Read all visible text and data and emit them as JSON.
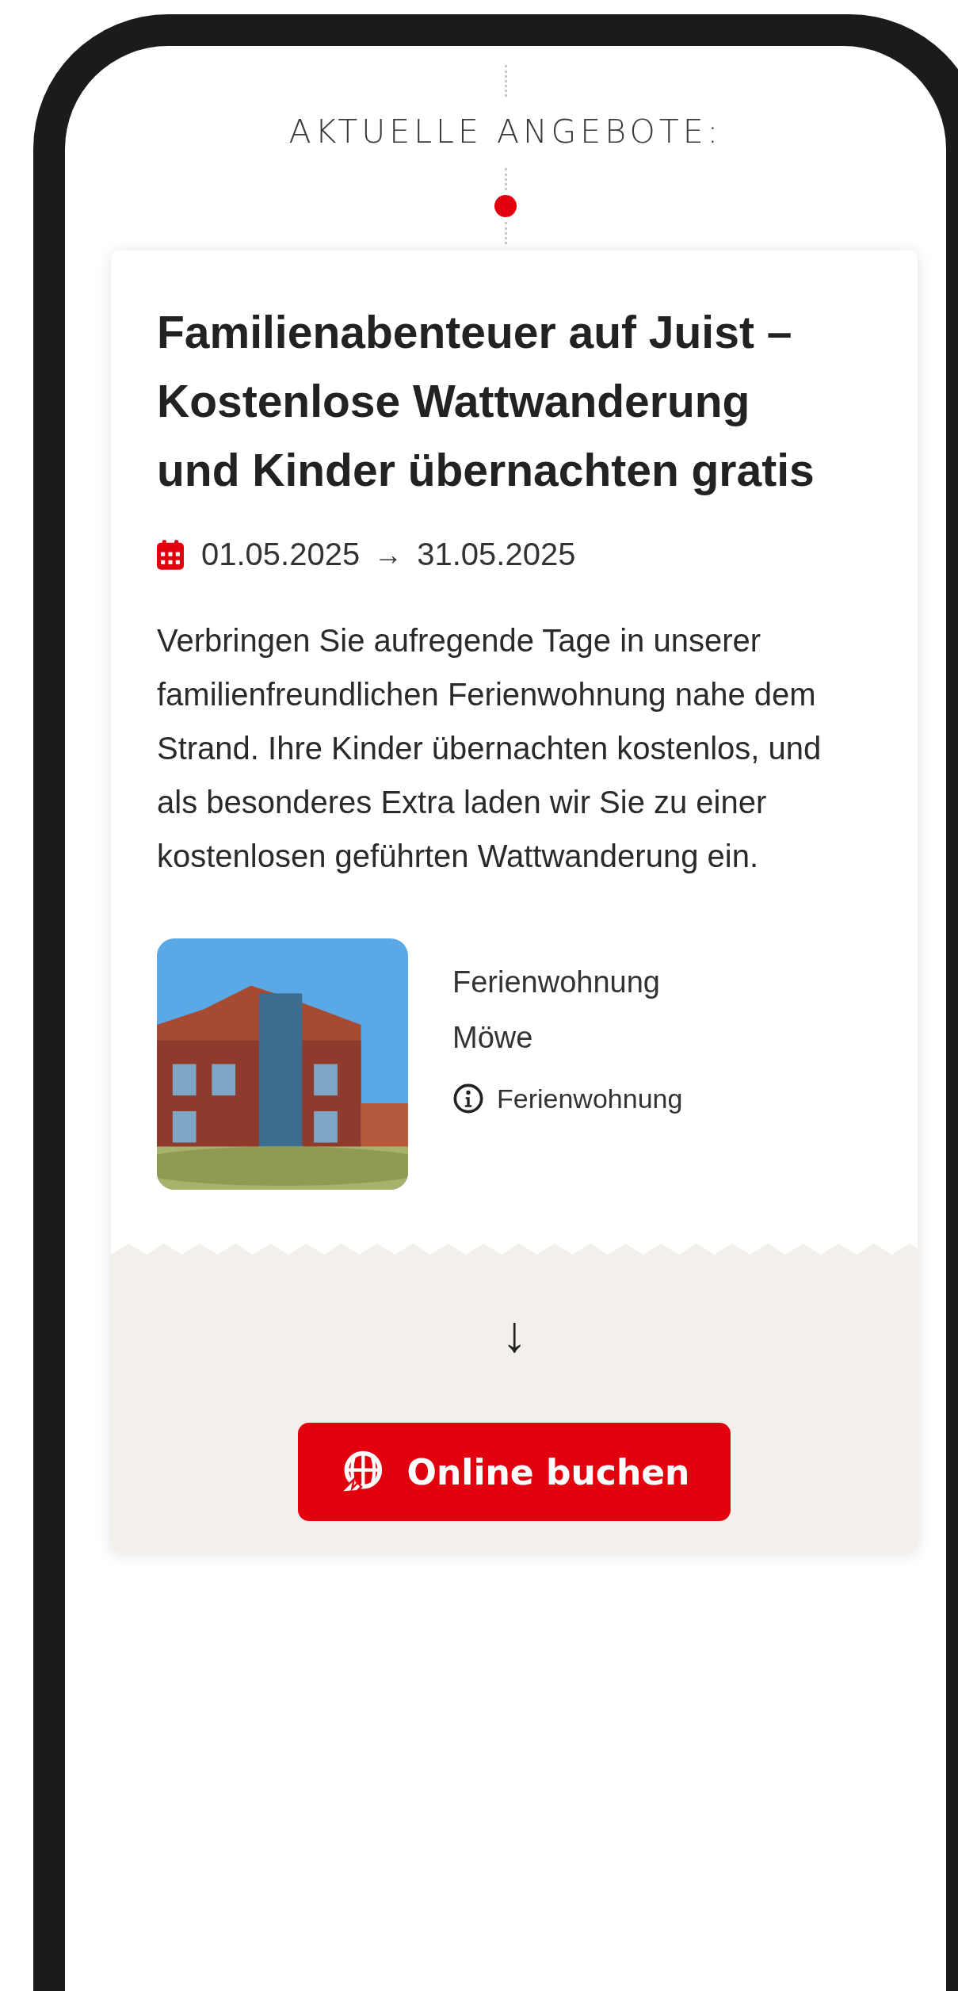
{
  "section_heading": "AKTUELLE ANGEBOTE:",
  "offer": {
    "title": "Familienabenteuer auf Juist – Kostenlose Wattwanderung und Kinder übernachten gratis",
    "date_start": "01.05.2025",
    "date_arrow": "→",
    "date_end": "31.05.2025",
    "description": "Verbringen Sie aufregende Tage in unserer familienfreundlichen Ferienwohnung nahe dem Strand. Ihre Kinder übernachten kostenlos, und als besonderes Extra laden wir Sie zu einer kostenlosen geführten Wattwanderung ein.",
    "property": {
      "name": "Ferienwohnung Möwe",
      "type": "Ferienwohnung"
    }
  },
  "scroll_arrow": "↓",
  "book_button": {
    "label": "Online buchen"
  }
}
